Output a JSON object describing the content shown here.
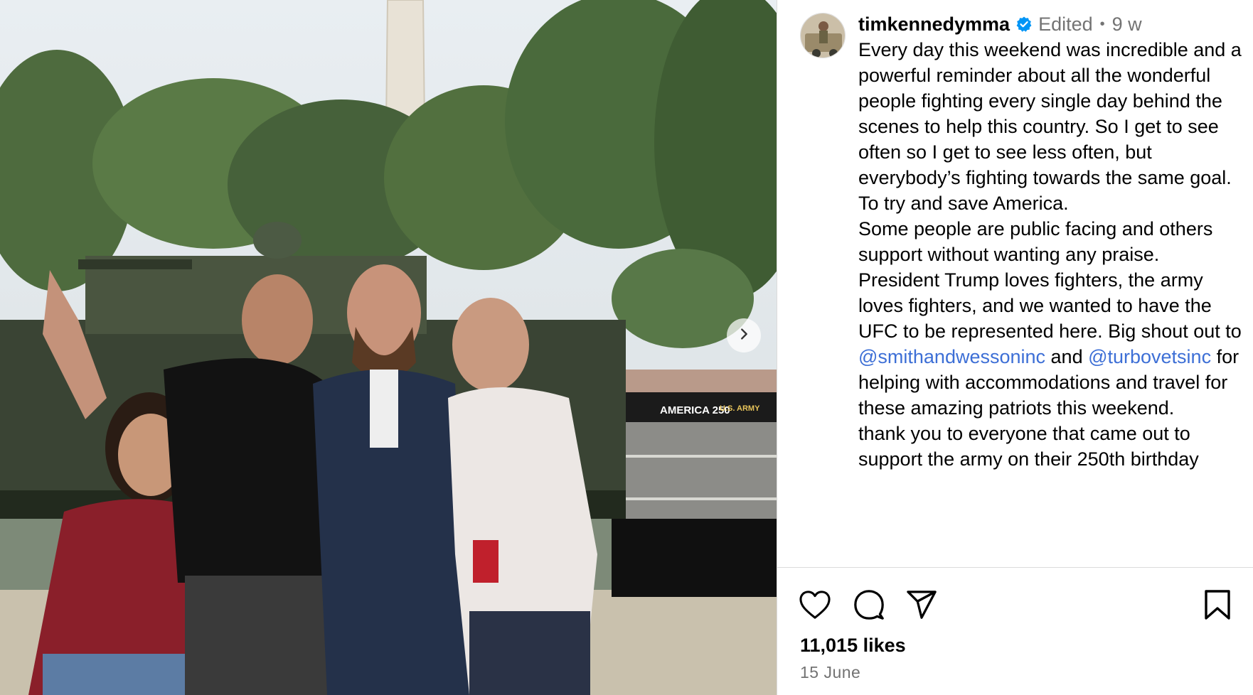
{
  "post": {
    "username": "timkennedymma",
    "edited_label": "Edited",
    "separator": "•",
    "time_ago": "9 w",
    "caption_paragraphs": [
      "Every day this weekend was incredible and a powerful reminder about all the wonderful people fighting every single day behind the scenes to help this country. So I get to see often so I get to see less often, but everybody’s fighting towards the same goal. To try and save America.",
      "Some people are public facing and others support without wanting any praise."
    ],
    "caption_p3_before": "President Trump loves fighters, the army loves fighters, and we wanted to have the UFC to be represented here. Big shout out to ",
    "mention_1": "@smithandwessoninc",
    "caption_p3_middle": " and ",
    "mention_2": "@turbovetsinc",
    "caption_p3_after": " for helping with accommodations and travel for these amazing patriots this weekend.",
    "caption_p4": "thank you to everyone that came out to support the army on their 250th birthday",
    "likes": "11,015 likes",
    "date": "15 June"
  },
  "photo": {
    "banner_left": "AMERICA 250",
    "banner_right": "U.S. ARMY"
  },
  "icons": {
    "like": "heart-icon",
    "comment": "comment-icon",
    "share": "share-icon",
    "save": "bookmark-icon",
    "next": "chevron-right-icon",
    "verified": "verified-badge-icon"
  },
  "colors": {
    "mention": "#3d6fd6",
    "verified": "#0095f6",
    "muted": "#737373"
  }
}
